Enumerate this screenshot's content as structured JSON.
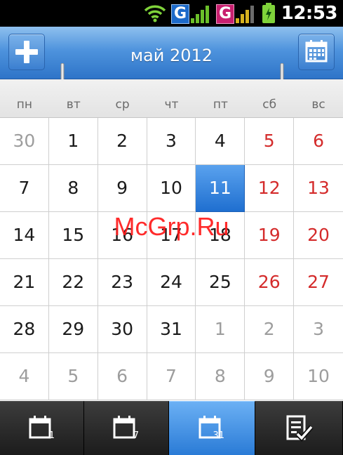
{
  "status_bar": {
    "time": "12:53",
    "network_badge_1": "G",
    "network_badge_2": "G",
    "icons": [
      "wifi-icon",
      "signal-icon",
      "signal-icon",
      "battery-icon"
    ]
  },
  "header": {
    "title": "май 2012",
    "add_icon": "plus-icon",
    "today_icon": "calendar-icon"
  },
  "weekdays": [
    "пн",
    "вт",
    "ср",
    "чт",
    "пт",
    "сб",
    "вс"
  ],
  "calendar": {
    "weeks": [
      [
        {
          "d": "30",
          "t": "other"
        },
        {
          "d": "1",
          "t": "normal"
        },
        {
          "d": "2",
          "t": "normal"
        },
        {
          "d": "3",
          "t": "normal"
        },
        {
          "d": "4",
          "t": "normal"
        },
        {
          "d": "5",
          "t": "weekend"
        },
        {
          "d": "6",
          "t": "weekend"
        }
      ],
      [
        {
          "d": "7",
          "t": "normal"
        },
        {
          "d": "8",
          "t": "normal"
        },
        {
          "d": "9",
          "t": "normal"
        },
        {
          "d": "10",
          "t": "normal"
        },
        {
          "d": "11",
          "t": "selected"
        },
        {
          "d": "12",
          "t": "weekend"
        },
        {
          "d": "13",
          "t": "weekend"
        }
      ],
      [
        {
          "d": "14",
          "t": "normal"
        },
        {
          "d": "15",
          "t": "normal"
        },
        {
          "d": "16",
          "t": "normal"
        },
        {
          "d": "17",
          "t": "normal"
        },
        {
          "d": "18",
          "t": "normal"
        },
        {
          "d": "19",
          "t": "weekend"
        },
        {
          "d": "20",
          "t": "weekend"
        }
      ],
      [
        {
          "d": "21",
          "t": "normal"
        },
        {
          "d": "22",
          "t": "normal"
        },
        {
          "d": "23",
          "t": "normal"
        },
        {
          "d": "24",
          "t": "normal"
        },
        {
          "d": "25",
          "t": "normal"
        },
        {
          "d": "26",
          "t": "weekend"
        },
        {
          "d": "27",
          "t": "weekend"
        }
      ],
      [
        {
          "d": "28",
          "t": "normal"
        },
        {
          "d": "29",
          "t": "normal"
        },
        {
          "d": "30",
          "t": "normal"
        },
        {
          "d": "31",
          "t": "normal"
        },
        {
          "d": "1",
          "t": "other"
        },
        {
          "d": "2",
          "t": "other"
        },
        {
          "d": "3",
          "t": "other"
        }
      ],
      [
        {
          "d": "4",
          "t": "other"
        },
        {
          "d": "5",
          "t": "other"
        },
        {
          "d": "6",
          "t": "other"
        },
        {
          "d": "7",
          "t": "other"
        },
        {
          "d": "8",
          "t": "other"
        },
        {
          "d": "9",
          "t": "other"
        },
        {
          "d": "10",
          "t": "other"
        }
      ]
    ]
  },
  "watermark": "McGrp.Ru",
  "tabs": [
    {
      "name": "tab-day-view",
      "icon": "calendar-day-icon",
      "label": "1",
      "active": false
    },
    {
      "name": "tab-week-view",
      "icon": "calendar-week-icon",
      "label": "7",
      "active": false
    },
    {
      "name": "tab-month-view",
      "icon": "calendar-month-icon",
      "label": "31",
      "active": true
    },
    {
      "name": "tab-agenda-view",
      "icon": "task-list-icon",
      "label": "",
      "active": false
    }
  ],
  "colors": {
    "accent": "#2e74c8",
    "selected": "#1f6fd0",
    "weekend": "#d42b2b",
    "other_month": "#9d9d9d"
  }
}
